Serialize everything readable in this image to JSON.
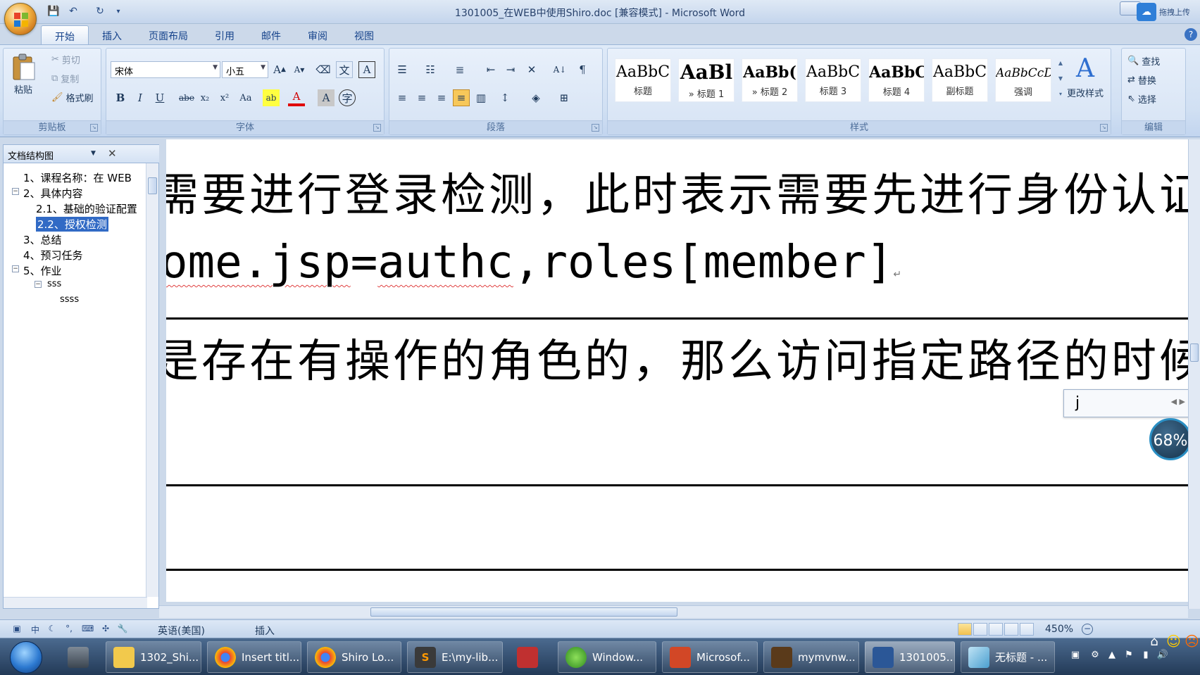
{
  "title": "1301005_在WEB中使用Shiro.doc [兼容模式] - Microsoft Word",
  "cloud_upload_label": "拖拽上传",
  "tabs": [
    "开始",
    "插入",
    "页面布局",
    "引用",
    "邮件",
    "审阅",
    "视图"
  ],
  "clipboard": {
    "paste": "粘贴",
    "cut": "剪切",
    "copy": "复制",
    "format_painter": "格式刷",
    "group": "剪贴板"
  },
  "font": {
    "name": "宋体",
    "size": "小五",
    "group": "字体"
  },
  "paragraph": {
    "group": "段落"
  },
  "styles": {
    "group": "样式",
    "items": [
      {
        "preview": "AaBbC",
        "name": "标题"
      },
      {
        "preview": "AaBl",
        "name": "» 标题 1"
      },
      {
        "preview": "AaBb(",
        "name": "» 标题 2"
      },
      {
        "preview": "AaBbC",
        "name": "标题 3"
      },
      {
        "preview": "AaBbC",
        "name": "标题 4"
      },
      {
        "preview": "AaBbC",
        "name": "副标题"
      },
      {
        "preview": "AaBbCcD",
        "name": "强调"
      }
    ],
    "change_styles": "更改样式"
  },
  "editing": {
    "find": "查找",
    "replace": "替换",
    "select": "选择",
    "group": "编辑"
  },
  "nav": {
    "title": "文档结构图",
    "items": [
      "1、课程名称：在 WEB",
      "2、具体内容",
      "2.1、基础的验证配置",
      "2.2、授权检测",
      "3、总结",
      "4、预习任务",
      "5、作业",
      "sss",
      "ssss"
    ]
  },
  "document": {
    "line1": "需要进行登录检测，此时表示需要先进行身份认证",
    "line2_prefix": "ome.jsp",
    "line2_eq": "=",
    "line2_authc": "authc",
    "line2_rest": ",roles[member]",
    "line3": "是存在有操作的角色的，那么访问指定路径的时候"
  },
  "ime": {
    "text": "j"
  },
  "zoom_badge": "68%",
  "status": {
    "language": "英语(美国)",
    "mode": "插入",
    "zoom": "450%"
  },
  "taskbar": {
    "items": [
      "1302_Shi...",
      "Insert titl...",
      "Shiro Lo...",
      "E:\\my-lib...",
      "Window...",
      "Microsof...",
      "mymvnw...",
      "1301005...",
      "无标题 - ..."
    ]
  },
  "colors": {
    "ribbon_bg": "#d1e0f3",
    "selection": "#316ac5",
    "taskbar": "#233a57"
  }
}
